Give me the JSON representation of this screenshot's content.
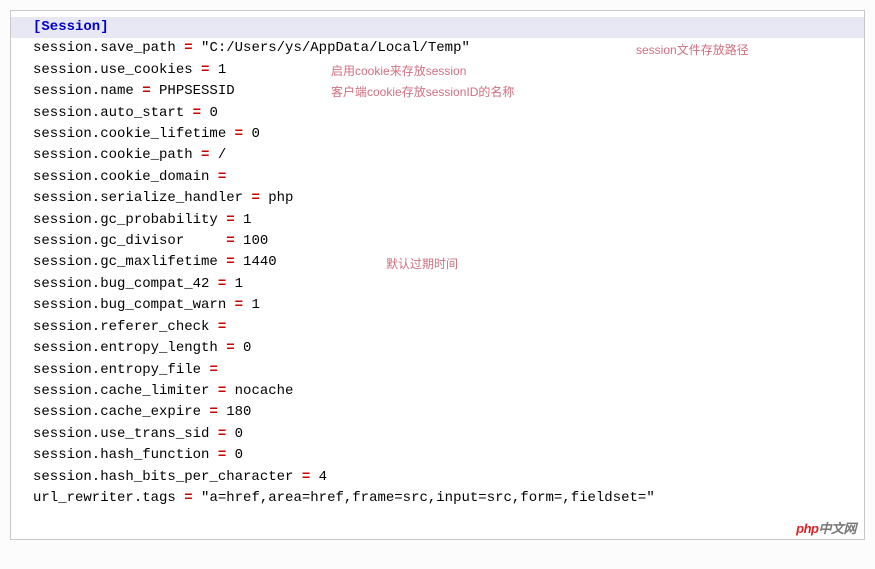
{
  "section_header": "[Session]",
  "lines": [
    {
      "key": "session.save_path ",
      "pad": "",
      "val": " \"C:/Users/ys/AppData/Local/Temp\""
    },
    {
      "key": "session.use_cookies ",
      "pad": "",
      "val": " 1"
    },
    {
      "key": "session.name ",
      "pad": "",
      "val": " PHPSESSID"
    },
    {
      "key": "session.auto_start ",
      "pad": "",
      "val": " 0"
    },
    {
      "key": "session.cookie_lifetime ",
      "pad": "",
      "val": " 0"
    },
    {
      "key": "session.cookie_path ",
      "pad": "",
      "val": " /"
    },
    {
      "key": "session.cookie_domain ",
      "pad": "",
      "val": ""
    },
    {
      "key": "session.serialize_handler ",
      "pad": "",
      "val": " php"
    },
    {
      "key": "session.gc_probability ",
      "pad": "",
      "val": " 1"
    },
    {
      "key": "session.gc_divisor",
      "pad": "     ",
      "val": " 100"
    },
    {
      "key": "session.gc_maxlifetime ",
      "pad": "",
      "val": " 1440"
    },
    {
      "key": "session.bug_compat_42 ",
      "pad": "",
      "val": " 1"
    },
    {
      "key": "session.bug_compat_warn ",
      "pad": "",
      "val": " 1"
    },
    {
      "key": "session.referer_check ",
      "pad": "",
      "val": ""
    },
    {
      "key": "session.entropy_length ",
      "pad": "",
      "val": " 0"
    },
    {
      "key": "session.entropy_file ",
      "pad": "",
      "val": ""
    },
    {
      "key": "session.cache_limiter ",
      "pad": "",
      "val": " nocache"
    },
    {
      "key": "session.cache_expire ",
      "pad": "",
      "val": " 180"
    },
    {
      "key": "session.use_trans_sid ",
      "pad": "",
      "val": " 0"
    },
    {
      "key": "session.hash_function ",
      "pad": "",
      "val": " 0"
    },
    {
      "key": "session.hash_bits_per_character ",
      "pad": "",
      "val": " 4"
    },
    {
      "key": "url_rewriter.tags ",
      "pad": "",
      "val": " \"a=href,area=href,frame=src,input=src,form=,fieldset=\""
    }
  ],
  "annotations": {
    "a1": "session文件存放路径",
    "a2": "启用cookie来存放session",
    "a3": "客户端cookie存放sessionID的名称",
    "a4": "默认过期时间"
  },
  "watermark": {
    "php": "php",
    "cn": "中文网"
  }
}
